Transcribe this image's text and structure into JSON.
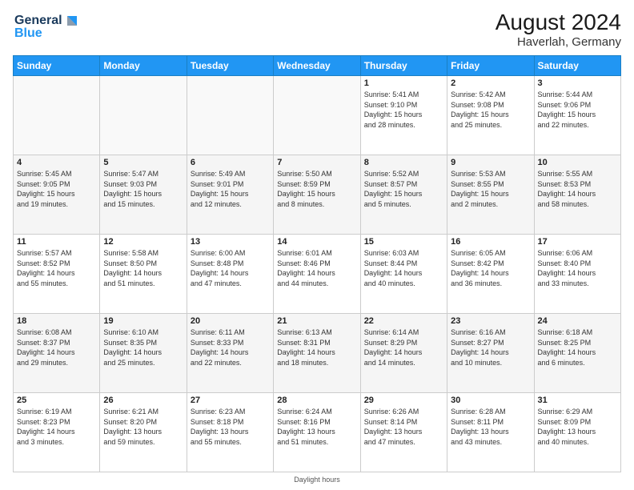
{
  "header": {
    "logo_line1": "General",
    "logo_line2": "Blue",
    "month_year": "August 2024",
    "location": "Haverlah, Germany"
  },
  "days_of_week": [
    "Sunday",
    "Monday",
    "Tuesday",
    "Wednesday",
    "Thursday",
    "Friday",
    "Saturday"
  ],
  "footer": {
    "daylight_label": "Daylight hours"
  },
  "weeks": [
    {
      "days": [
        {
          "number": "",
          "info": ""
        },
        {
          "number": "",
          "info": ""
        },
        {
          "number": "",
          "info": ""
        },
        {
          "number": "",
          "info": ""
        },
        {
          "number": "1",
          "info": "Sunrise: 5:41 AM\nSunset: 9:10 PM\nDaylight: 15 hours\nand 28 minutes."
        },
        {
          "number": "2",
          "info": "Sunrise: 5:42 AM\nSunset: 9:08 PM\nDaylight: 15 hours\nand 25 minutes."
        },
        {
          "number": "3",
          "info": "Sunrise: 5:44 AM\nSunset: 9:06 PM\nDaylight: 15 hours\nand 22 minutes."
        }
      ]
    },
    {
      "days": [
        {
          "number": "4",
          "info": "Sunrise: 5:45 AM\nSunset: 9:05 PM\nDaylight: 15 hours\nand 19 minutes."
        },
        {
          "number": "5",
          "info": "Sunrise: 5:47 AM\nSunset: 9:03 PM\nDaylight: 15 hours\nand 15 minutes."
        },
        {
          "number": "6",
          "info": "Sunrise: 5:49 AM\nSunset: 9:01 PM\nDaylight: 15 hours\nand 12 minutes."
        },
        {
          "number": "7",
          "info": "Sunrise: 5:50 AM\nSunset: 8:59 PM\nDaylight: 15 hours\nand 8 minutes."
        },
        {
          "number": "8",
          "info": "Sunrise: 5:52 AM\nSunset: 8:57 PM\nDaylight: 15 hours\nand 5 minutes."
        },
        {
          "number": "9",
          "info": "Sunrise: 5:53 AM\nSunset: 8:55 PM\nDaylight: 15 hours\nand 2 minutes."
        },
        {
          "number": "10",
          "info": "Sunrise: 5:55 AM\nSunset: 8:53 PM\nDaylight: 14 hours\nand 58 minutes."
        }
      ]
    },
    {
      "days": [
        {
          "number": "11",
          "info": "Sunrise: 5:57 AM\nSunset: 8:52 PM\nDaylight: 14 hours\nand 55 minutes."
        },
        {
          "number": "12",
          "info": "Sunrise: 5:58 AM\nSunset: 8:50 PM\nDaylight: 14 hours\nand 51 minutes."
        },
        {
          "number": "13",
          "info": "Sunrise: 6:00 AM\nSunset: 8:48 PM\nDaylight: 14 hours\nand 47 minutes."
        },
        {
          "number": "14",
          "info": "Sunrise: 6:01 AM\nSunset: 8:46 PM\nDaylight: 14 hours\nand 44 minutes."
        },
        {
          "number": "15",
          "info": "Sunrise: 6:03 AM\nSunset: 8:44 PM\nDaylight: 14 hours\nand 40 minutes."
        },
        {
          "number": "16",
          "info": "Sunrise: 6:05 AM\nSunset: 8:42 PM\nDaylight: 14 hours\nand 36 minutes."
        },
        {
          "number": "17",
          "info": "Sunrise: 6:06 AM\nSunset: 8:40 PM\nDaylight: 14 hours\nand 33 minutes."
        }
      ]
    },
    {
      "days": [
        {
          "number": "18",
          "info": "Sunrise: 6:08 AM\nSunset: 8:37 PM\nDaylight: 14 hours\nand 29 minutes."
        },
        {
          "number": "19",
          "info": "Sunrise: 6:10 AM\nSunset: 8:35 PM\nDaylight: 14 hours\nand 25 minutes."
        },
        {
          "number": "20",
          "info": "Sunrise: 6:11 AM\nSunset: 8:33 PM\nDaylight: 14 hours\nand 22 minutes."
        },
        {
          "number": "21",
          "info": "Sunrise: 6:13 AM\nSunset: 8:31 PM\nDaylight: 14 hours\nand 18 minutes."
        },
        {
          "number": "22",
          "info": "Sunrise: 6:14 AM\nSunset: 8:29 PM\nDaylight: 14 hours\nand 14 minutes."
        },
        {
          "number": "23",
          "info": "Sunrise: 6:16 AM\nSunset: 8:27 PM\nDaylight: 14 hours\nand 10 minutes."
        },
        {
          "number": "24",
          "info": "Sunrise: 6:18 AM\nSunset: 8:25 PM\nDaylight: 14 hours\nand 6 minutes."
        }
      ]
    },
    {
      "days": [
        {
          "number": "25",
          "info": "Sunrise: 6:19 AM\nSunset: 8:23 PM\nDaylight: 14 hours\nand 3 minutes."
        },
        {
          "number": "26",
          "info": "Sunrise: 6:21 AM\nSunset: 8:20 PM\nDaylight: 13 hours\nand 59 minutes."
        },
        {
          "number": "27",
          "info": "Sunrise: 6:23 AM\nSunset: 8:18 PM\nDaylight: 13 hours\nand 55 minutes."
        },
        {
          "number": "28",
          "info": "Sunrise: 6:24 AM\nSunset: 8:16 PM\nDaylight: 13 hours\nand 51 minutes."
        },
        {
          "number": "29",
          "info": "Sunrise: 6:26 AM\nSunset: 8:14 PM\nDaylight: 13 hours\nand 47 minutes."
        },
        {
          "number": "30",
          "info": "Sunrise: 6:28 AM\nSunset: 8:11 PM\nDaylight: 13 hours\nand 43 minutes."
        },
        {
          "number": "31",
          "info": "Sunrise: 6:29 AM\nSunset: 8:09 PM\nDaylight: 13 hours\nand 40 minutes."
        }
      ]
    }
  ]
}
